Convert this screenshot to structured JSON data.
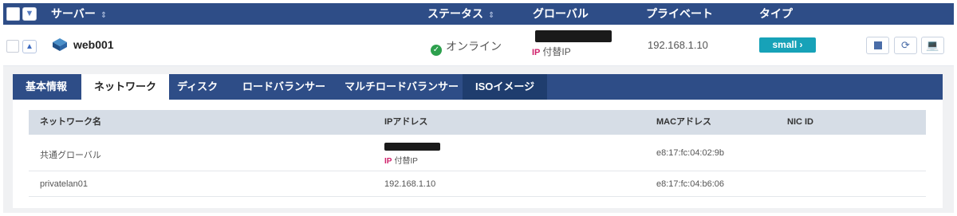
{
  "header": {
    "server": "サーバー",
    "status": "ステータス",
    "global": "グローバル",
    "private": "プライベート",
    "type": "タイプ"
  },
  "server": {
    "name": "web001",
    "status": "オンライン",
    "global_ip_badge": "IP",
    "global_ip_label": "付替IP",
    "private_ip": "192.168.1.10",
    "type": "small"
  },
  "tabs": [
    "基本情報",
    "ネットワーク",
    "ディスク",
    "ロードバランサー",
    "マルチロードバランサー",
    "ISOイメージ"
  ],
  "table": {
    "columns": [
      "ネットワーク名",
      "IPアドレス",
      "MACアドレス",
      "NIC ID"
    ],
    "rows": [
      {
        "network": "共通グローバル",
        "ip_badge": "IP",
        "ip_label": "付替IP",
        "mac": "e8:17:fc:04:02:9b",
        "nic_id": ""
      },
      {
        "network": "privatelan01",
        "ip": "192.168.1.10",
        "mac": "e8:17:fc:04:b6:06",
        "nic_id": ""
      }
    ]
  },
  "colors": {
    "header": "#2e4d87",
    "type_button": "#17a2b8",
    "online": "#2da04d",
    "ip_badge": "#d0216b"
  },
  "icons": [
    "chevron-down-icon",
    "sort-icon",
    "chevron-up-icon",
    "server-icon",
    "check-circle-icon",
    "chevron-right-icon",
    "stop-icon",
    "refresh-icon",
    "console-icon"
  ]
}
